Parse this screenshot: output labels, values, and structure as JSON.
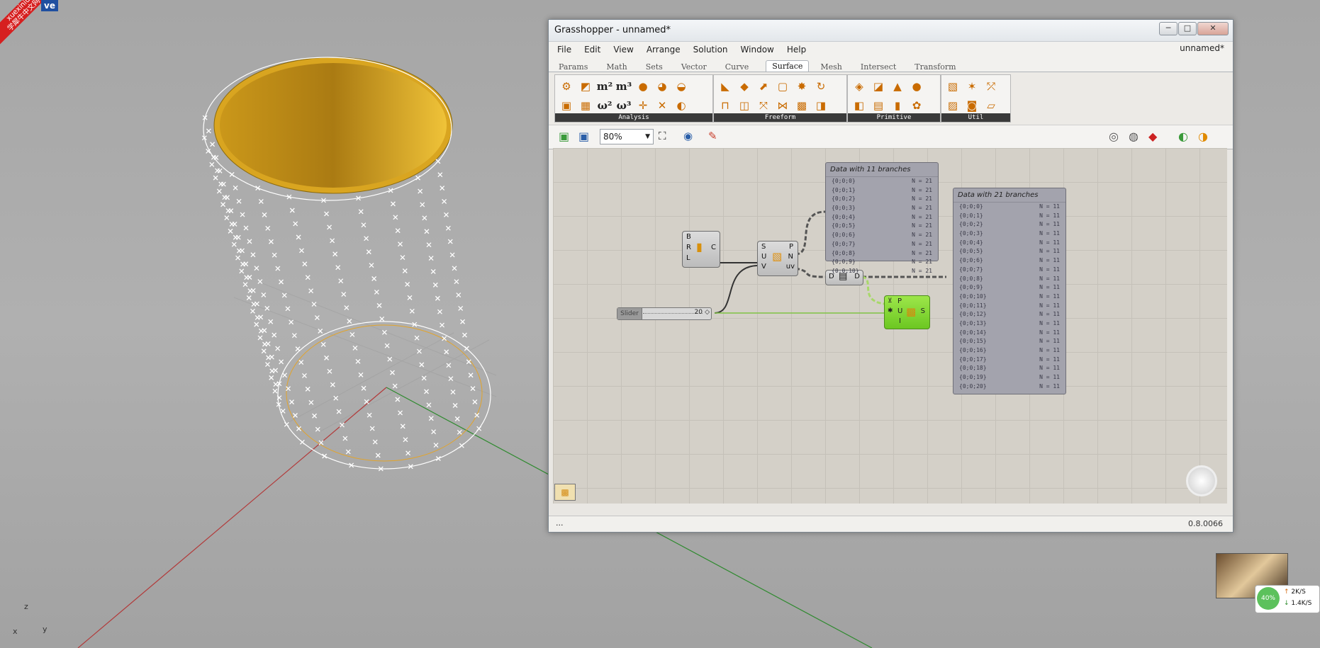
{
  "watermark": {
    "line1": "xuexiniu",
    "line2": "学犀牛中文网",
    "tag": "ve"
  },
  "viewport": {
    "axis_x": "x",
    "axis_y": "y",
    "axis_z": "z"
  },
  "window": {
    "title": "Grasshopper - unnamed*",
    "doc_name": "unnamed*",
    "controls": {
      "minimize": "─",
      "maximize": "□",
      "close": "✕"
    }
  },
  "menu": [
    "File",
    "Edit",
    "View",
    "Arrange",
    "Solution",
    "Window",
    "Help"
  ],
  "tabs": [
    "Params",
    "Math",
    "Sets",
    "Vector",
    "Curve",
    "Surface",
    "Mesh",
    "Intersect",
    "Transform"
  ],
  "active_tab": "Surface",
  "ribbon_panels": [
    "Analysis",
    "Freeform",
    "Primitive",
    "Util"
  ],
  "toolbar": {
    "zoom": "80%"
  },
  "components": {
    "cylinder": {
      "inputs": [
        "B",
        "R",
        "L"
      ],
      "output": "C"
    },
    "divide_surface": {
      "inputs": [
        "S",
        "U",
        "V"
      ],
      "outputs": [
        "P",
        "N",
        "uv"
      ]
    },
    "data_param": {
      "input": "D",
      "output": "D"
    },
    "surface_from_points": {
      "inputs": [
        "P",
        "U",
        "I"
      ],
      "output": "S"
    },
    "slider": {
      "name": "Slider",
      "value": "20"
    }
  },
  "panel1": {
    "title": "Data with 11 branches",
    "rows": [
      [
        "{0;0;0}",
        "N = 21"
      ],
      [
        "{0;0;1}",
        "N = 21"
      ],
      [
        "{0;0;2}",
        "N = 21"
      ],
      [
        "{0;0;3}",
        "N = 21"
      ],
      [
        "{0;0;4}",
        "N = 21"
      ],
      [
        "{0;0;5}",
        "N = 21"
      ],
      [
        "{0;0;6}",
        "N = 21"
      ],
      [
        "{0;0;7}",
        "N = 21"
      ],
      [
        "{0;0;8}",
        "N = 21"
      ],
      [
        "{0;0;9}",
        "N = 21"
      ],
      [
        "{0;0;10}",
        "N = 21"
      ]
    ]
  },
  "panel2": {
    "title": "Data with 21 branches",
    "rows": [
      [
        "{0;0;0}",
        "N = 11"
      ],
      [
        "{0;0;1}",
        "N = 11"
      ],
      [
        "{0;0;2}",
        "N = 11"
      ],
      [
        "{0;0;3}",
        "N = 11"
      ],
      [
        "{0;0;4}",
        "N = 11"
      ],
      [
        "{0;0;5}",
        "N = 11"
      ],
      [
        "{0;0;6}",
        "N = 11"
      ],
      [
        "{0;0;7}",
        "N = 11"
      ],
      [
        "{0;0;8}",
        "N = 11"
      ],
      [
        "{0;0;9}",
        "N = 11"
      ],
      [
        "{0;0;10}",
        "N = 11"
      ],
      [
        "{0;0;11}",
        "N = 11"
      ],
      [
        "{0;0;12}",
        "N = 11"
      ],
      [
        "{0;0;13}",
        "N = 11"
      ],
      [
        "{0;0;14}",
        "N = 11"
      ],
      [
        "{0;0;15}",
        "N = 11"
      ],
      [
        "{0;0;16}",
        "N = 11"
      ],
      [
        "{0;0;17}",
        "N = 11"
      ],
      [
        "{0;0;18}",
        "N = 11"
      ],
      [
        "{0;0;19}",
        "N = 11"
      ],
      [
        "{0;0;20}",
        "N = 11"
      ]
    ]
  },
  "status": {
    "left": "...",
    "version": "0.8.0066"
  },
  "tray": {
    "percent": "40%",
    "upload": "2K/S",
    "download": "1.4K/S"
  },
  "colors": {
    "surface": "#e0a91c",
    "accent_green": "#86d53a",
    "panel": "#a3a3ad"
  }
}
